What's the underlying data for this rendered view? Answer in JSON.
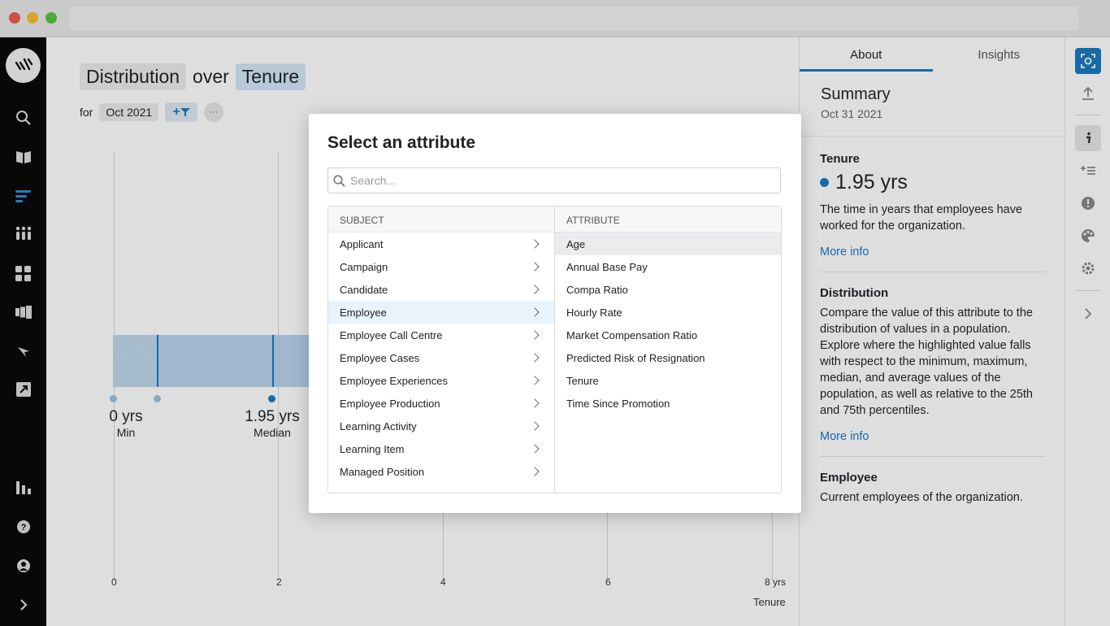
{
  "header": {
    "title_part1": "Distribution",
    "title_connector": "over",
    "title_part2": "Tenure",
    "for_label": "for",
    "date_filter": "Oct 2021",
    "filter_glyph": "+",
    "more_glyph": "···"
  },
  "chart": {
    "x_ticks": [
      "0",
      "2",
      "4",
      "6",
      "8 yrs"
    ],
    "x_label": "Tenure",
    "stats": [
      {
        "value": "0 yrs",
        "label": "Min"
      },
      {
        "value": "1.95 yrs",
        "label": "Median"
      }
    ]
  },
  "right_panel": {
    "tabs": [
      "About",
      "Insights"
    ],
    "summary_title": "Summary",
    "summary_date": "Oct 31 2021",
    "attribute_name": "Tenure",
    "attribute_value": "1.95 yrs",
    "attribute_desc": "The time in years that employees have worked for the organization.",
    "more_info": "More info",
    "distribution_title": "Distribution",
    "distribution_desc": "Compare the value of this attribute to the distribution of values in a population. Explore where the highlighted value falls with respect to the minimum, maximum, median, and average values of the population, as well as relative to the 25th and 75th percentiles.",
    "subject_title": "Employee",
    "subject_desc": "Current employees of the organization."
  },
  "modal": {
    "title": "Select an attribute",
    "search_placeholder": "Search...",
    "subject_header": "SUBJECT",
    "attribute_header": "ATTRIBUTE",
    "subjects": [
      "Applicant",
      "Campaign",
      "Candidate",
      "Employee",
      "Employee Call Centre",
      "Employee Cases",
      "Employee Experiences",
      "Employee Production",
      "Learning Activity",
      "Learning Item",
      "Managed Position"
    ],
    "selected_subject": "Employee",
    "attributes": [
      "Age",
      "Annual Base Pay",
      "Compa Ratio",
      "Hourly Rate",
      "Market Compensation Ratio",
      "Predicted Risk of Resignation",
      "Tenure",
      "Time Since Promotion"
    ],
    "highlighted_attribute": "Age"
  },
  "colors": {
    "accent": "#1b79c0",
    "nav_bg": "#0a0a0a",
    "bar_fill": "#b7d4ec"
  }
}
